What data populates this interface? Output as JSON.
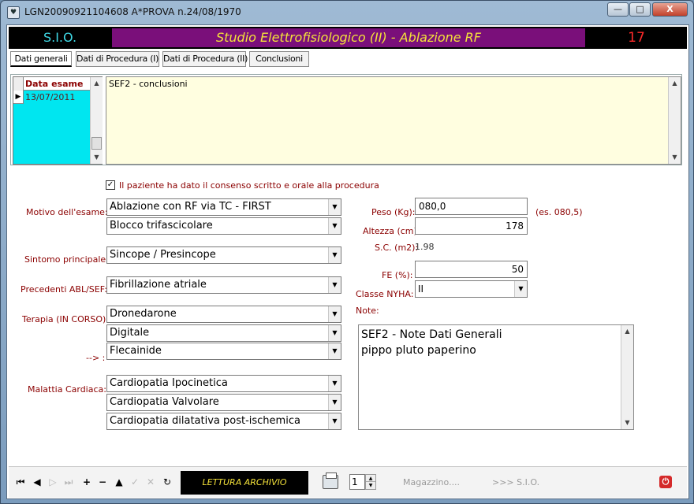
{
  "window": {
    "title": "LGN20090921104608 A*PROVA n.24/08/1970",
    "app_icon": "app-icon",
    "buttons": {
      "minimize": "—",
      "maximize": "□",
      "close": "X"
    }
  },
  "header": {
    "brand": "S.I.O.",
    "title": "Studio Elettrofisiologico (II)  -  Ablazione RF",
    "number": "17",
    "colors": {
      "brand": "#3fd9e6",
      "title_bg": "#7a0f7a",
      "title_fg": "#f4e23a",
      "number": "#ff2a2a"
    }
  },
  "tabs": [
    {
      "label": "Dati generali",
      "active": true
    },
    {
      "label": "Dati di Procedura (I)",
      "active": false
    },
    {
      "label": "Dati di Procedura (II)",
      "active": false
    },
    {
      "label": "Conclusioni",
      "active": false
    }
  ],
  "exam_grid": {
    "header": "Data esame",
    "rows": [
      "13/07/2011"
    ]
  },
  "conclusions_memo": "SEF2 - conclusioni",
  "form": {
    "consent_checked": true,
    "consent_label": "Il paziente ha dato il consenso scritto e orale alla procedura",
    "motivo_label": "Motivo dell'esame:",
    "motivo_1": "Ablazione con RF via TC - FIRST",
    "motivo_2": "Blocco trifascicolare",
    "sintomo_label": "Sintomo principale:",
    "sintomo": "Sincope / Presincope",
    "precedenti_label": "Precedenti ABL/SEF:",
    "precedenti": "Fibrillazione atriale",
    "terapia_label": "Terapia (IN CORSO):",
    "terapia_1": "Dronedarone",
    "terapia_2": "Digitale",
    "terapia_3": "Flecainide",
    "arrow_label": "--> :",
    "malattia_label": "Malattia Cardiaca: :",
    "malattia_1": "Cardiopatia Ipocinetica",
    "malattia_2": "Cardiopatia Valvolare",
    "malattia_3": "Cardiopatia dilatativa post-ischemica",
    "peso_label": "Peso (Kg):",
    "peso": "080,0",
    "peso_hint": "(es. 080,5)",
    "altezza_label": "Altezza (cm):",
    "altezza": "178",
    "sc_label": "S.C. (m2):",
    "sc": "1.98",
    "fe_label": "FE (%):",
    "fe": "50",
    "nyha_label": "Classe NYHA:",
    "nyha": "II",
    "note_label": "Note:",
    "note": "SEF2 - Note Dati Generali\npippo pluto paperino"
  },
  "toolbar": {
    "status": "LETTURA ARCHIVIO",
    "copies": "1",
    "magazzino": "Magazzino....",
    "sio_link": ">>> S.I.O."
  }
}
